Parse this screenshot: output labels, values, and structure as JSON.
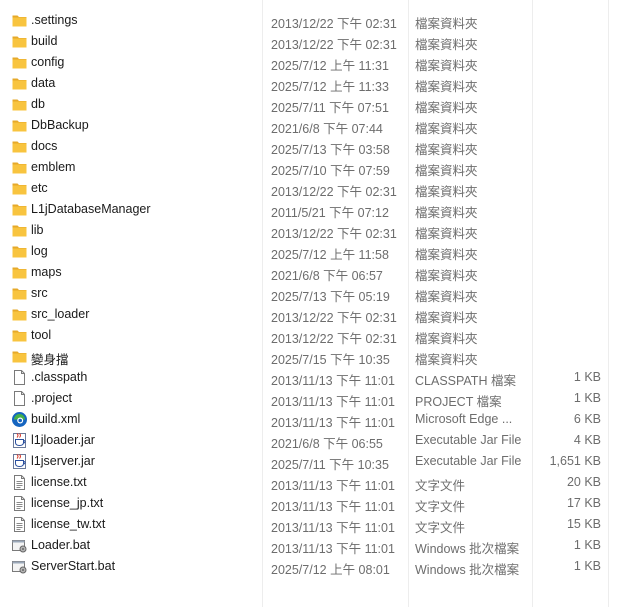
{
  "files": [
    {
      "name": ".settings",
      "date": "2013/12/22 下午 02:31",
      "type": "檔案資料夾",
      "size": "",
      "icon": "folder-icon"
    },
    {
      "name": "build",
      "date": "2013/12/22 下午 02:31",
      "type": "檔案資料夾",
      "size": "",
      "icon": "folder-icon"
    },
    {
      "name": "config",
      "date": "2025/7/12 上午 11:31",
      "type": "檔案資料夾",
      "size": "",
      "icon": "folder-icon"
    },
    {
      "name": "data",
      "date": "2025/7/12 上午 11:33",
      "type": "檔案資料夾",
      "size": "",
      "icon": "folder-icon"
    },
    {
      "name": "db",
      "date": "2025/7/11 下午 07:51",
      "type": "檔案資料夾",
      "size": "",
      "icon": "folder-icon"
    },
    {
      "name": "DbBackup",
      "date": "2021/6/8 下午 07:44",
      "type": "檔案資料夾",
      "size": "",
      "icon": "folder-icon"
    },
    {
      "name": "docs",
      "date": "2025/7/13 下午 03:58",
      "type": "檔案資料夾",
      "size": "",
      "icon": "folder-icon"
    },
    {
      "name": "emblem",
      "date": "2025/7/10 下午 07:59",
      "type": "檔案資料夾",
      "size": "",
      "icon": "folder-icon"
    },
    {
      "name": "etc",
      "date": "2013/12/22 下午 02:31",
      "type": "檔案資料夾",
      "size": "",
      "icon": "folder-icon"
    },
    {
      "name": "L1jDatabaseManager",
      "date": "2011/5/21 下午 07:12",
      "type": "檔案資料夾",
      "size": "",
      "icon": "folder-icon"
    },
    {
      "name": "lib",
      "date": "2013/12/22 下午 02:31",
      "type": "檔案資料夾",
      "size": "",
      "icon": "folder-icon"
    },
    {
      "name": "log",
      "date": "2025/7/12 上午 11:58",
      "type": "檔案資料夾",
      "size": "",
      "icon": "folder-icon"
    },
    {
      "name": "maps",
      "date": "2021/6/8 下午 06:57",
      "type": "檔案資料夾",
      "size": "",
      "icon": "folder-icon"
    },
    {
      "name": "src",
      "date": "2025/7/13 下午 05:19",
      "type": "檔案資料夾",
      "size": "",
      "icon": "folder-icon"
    },
    {
      "name": "src_loader",
      "date": "2013/12/22 下午 02:31",
      "type": "檔案資料夾",
      "size": "",
      "icon": "folder-icon"
    },
    {
      "name": "tool",
      "date": "2013/12/22 下午 02:31",
      "type": "檔案資料夾",
      "size": "",
      "icon": "folder-icon"
    },
    {
      "name": "變身擋",
      "date": "2025/7/15 下午 10:35",
      "type": "檔案資料夾",
      "size": "",
      "icon": "folder-icon"
    },
    {
      "name": ".classpath",
      "date": "2013/11/13 下午 11:01",
      "type": "CLASSPATH 檔案",
      "size": "1 KB",
      "icon": "document-icon"
    },
    {
      "name": ".project",
      "date": "2013/11/13 下午 11:01",
      "type": "PROJECT 檔案",
      "size": "1 KB",
      "icon": "document-icon"
    },
    {
      "name": "build.xml",
      "date": "2013/11/13 下午 11:01",
      "type": "Microsoft Edge ...",
      "size": "6 KB",
      "icon": "edge-icon"
    },
    {
      "name": "l1jloader.jar",
      "date": "2021/6/8 下午 06:55",
      "type": "Executable Jar File",
      "size": "4 KB",
      "icon": "jar-icon"
    },
    {
      "name": "l1jserver.jar",
      "date": "2025/7/11 下午 10:35",
      "type": "Executable Jar File",
      "size": "1,651 KB",
      "icon": "jar-icon"
    },
    {
      "name": "license.txt",
      "date": "2013/11/13 下午 11:01",
      "type": "文字文件",
      "size": "20 KB",
      "icon": "text-file-icon"
    },
    {
      "name": "license_jp.txt",
      "date": "2013/11/13 下午 11:01",
      "type": "文字文件",
      "size": "17 KB",
      "icon": "text-file-icon"
    },
    {
      "name": "license_tw.txt",
      "date": "2013/11/13 下午 11:01",
      "type": "文字文件",
      "size": "15 KB",
      "icon": "text-file-icon"
    },
    {
      "name": "Loader.bat",
      "date": "2013/11/13 下午 11:01",
      "type": "Windows 批次檔案",
      "size": "1 KB",
      "icon": "batch-file-icon"
    },
    {
      "name": "ServerStart.bat",
      "date": "2025/7/12 上午 08:01",
      "type": "Windows 批次檔案",
      "size": "1 KB",
      "icon": "batch-file-icon"
    }
  ],
  "colors": {
    "folder": "#f8c43f",
    "folder_dark": "#e6a92a",
    "edge_blue": "#1565c0",
    "edge_green": "#43b049",
    "jar_red": "#d9392b",
    "secondary_text": "#6d6d6d"
  }
}
